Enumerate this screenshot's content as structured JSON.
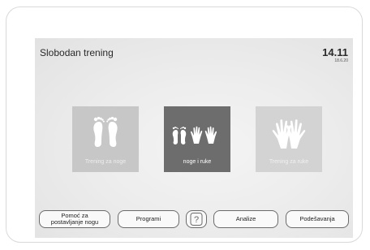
{
  "header": {
    "title": "Slobodan trening",
    "time": "14.11",
    "date": "18.6.20"
  },
  "modes": [
    {
      "label": "Trening za noge",
      "icon": "feet-icon"
    },
    {
      "label": "noge i ruke",
      "icon": "feet-and-hands-icon"
    },
    {
      "label": "Trening za ruke",
      "icon": "hands-icon"
    }
  ],
  "footer": {
    "help_label_line1": "Pomoć za",
    "help_label_line2": "postavljanje nogu",
    "programs_label": "Programi",
    "question_label": "?",
    "analize_label": "Analize",
    "settings_label": "Podešavanja"
  }
}
